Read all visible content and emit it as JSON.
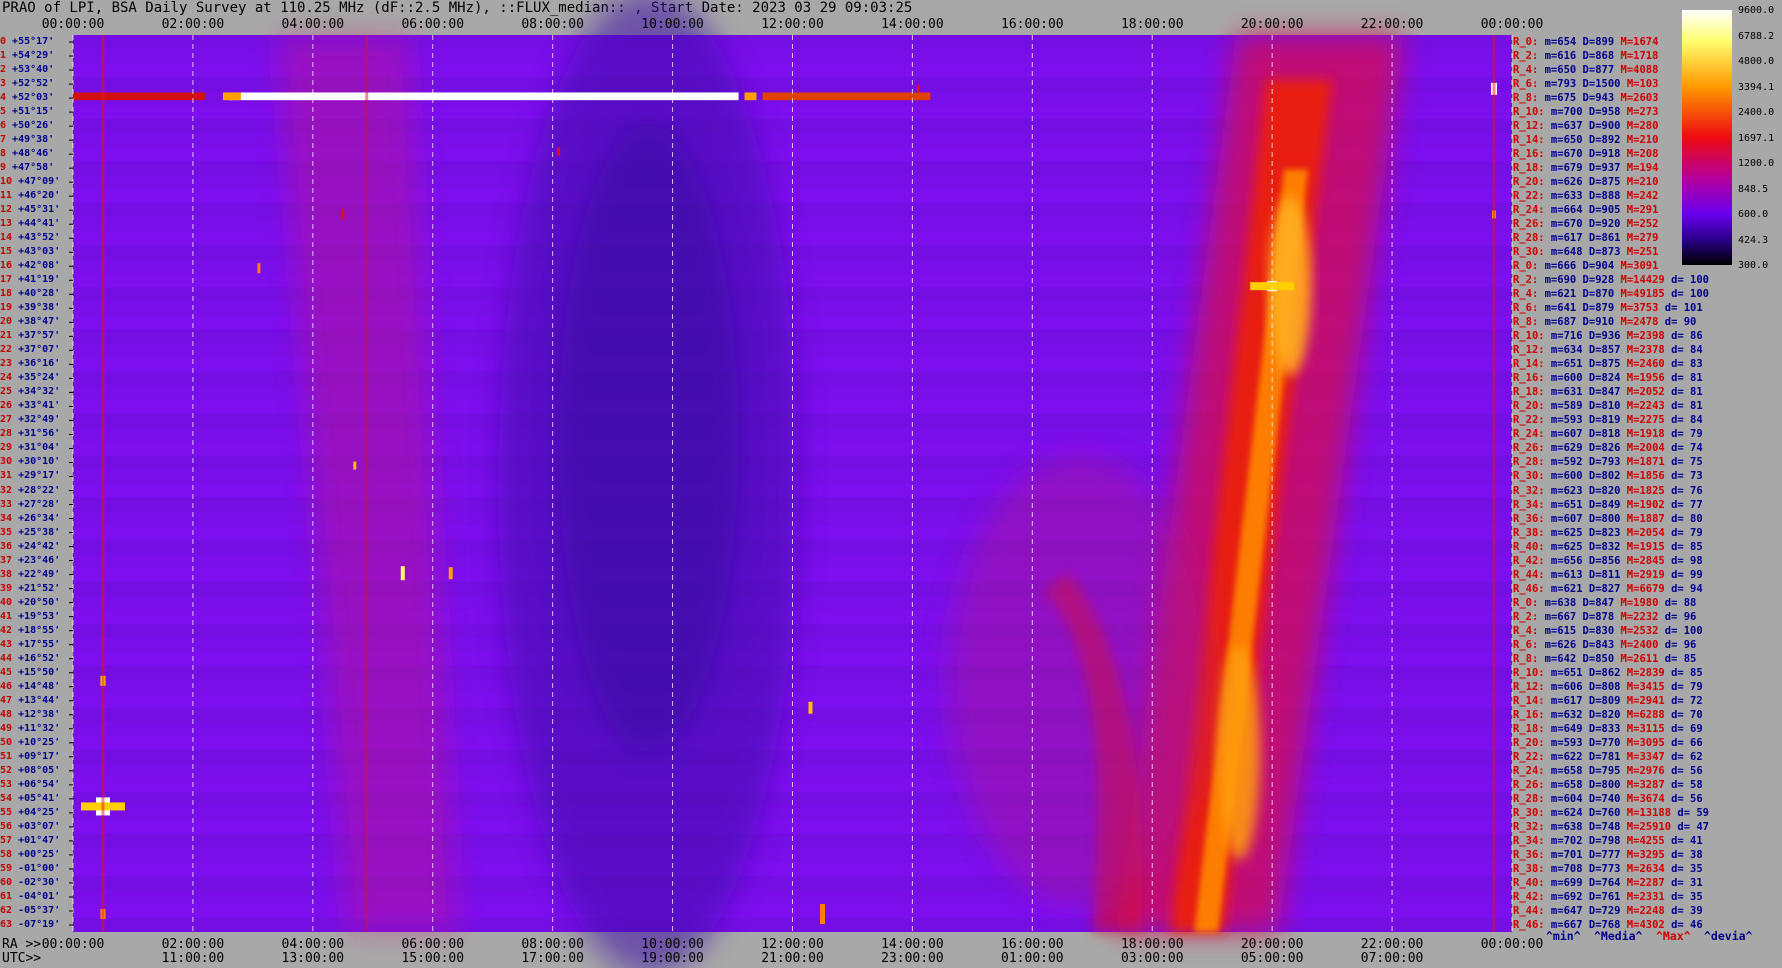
{
  "title": "PRAO of LPI, BSA Daily Survey at 110.25 MHz (dF::2.5 MHz), ::FLUX_median:: , Start Date: 2023 03 29 09:03:25",
  "corner_labels": {
    "ra": "RA >>",
    "utc": "UTC>>"
  },
  "footer_labels": {
    "min": "^min^",
    "median": "^Media^",
    "max": "^Max^",
    "devia": "^devia^"
  },
  "chart_data": {
    "type": "heatmap",
    "colors": {
      "low": "#000000",
      "mid1": "#6a00ff",
      "mid2": "#b000a0",
      "mid3": "#e80000",
      "high": "#ff9400",
      "top": "#ffffff"
    },
    "x_axis_ra": [
      "00:00:00",
      "02:00:00",
      "04:00:00",
      "06:00:00",
      "08:00:00",
      "10:00:00",
      "12:00:00",
      "14:00:00",
      "16:00:00",
      "18:00:00",
      "20:00:00",
      "22:00:00",
      "00:00:00"
    ],
    "x_axis_utc": [
      "11:00:00",
      "13:00:00",
      "15:00:00",
      "17:00:00",
      "19:00:00",
      "21:00:00",
      "23:00:00",
      "01:00:00",
      "03:00:00",
      "05:00:00",
      "07:00:00"
    ],
    "colorbar": {
      "ticks": [
        "9600.0",
        "6788.2",
        "4800.0",
        "3394.1",
        "2400.0",
        "1697.1",
        "1200.0",
        "848.5",
        "600.0",
        "424.3",
        "300.0"
      ],
      "min": 300,
      "max": 9600,
      "scale": "log"
    },
    "declinations": [
      "+55°17'",
      "+54°29'",
      "+53°40'",
      "+52°52'",
      "+52°03'",
      "+51°15'",
      "+50°26'",
      "+49°38'",
      "+48°46'",
      "+47°58'",
      "+47°09'",
      "+46°20'",
      "+45°31'",
      "+44°41'",
      "+43°52'",
      "+43°03'",
      "+42°08'",
      "+41°19'",
      "+40°28'",
      "+39°38'",
      "+38°47'",
      "+37°57'",
      "+37°07'",
      "+36°16'",
      "+35°24'",
      "+34°32'",
      "+33°41'",
      "+32°49'",
      "+31°56'",
      "+31°04'",
      "+30°10'",
      "+29°17'",
      "+28°22'",
      "+27°28'",
      "+26°34'",
      "+25°38'",
      "+24°42'",
      "+23°46'",
      "+22°49'",
      "+21°52'",
      "+20°50'",
      "+19°53'",
      "+18°55'",
      "+17°55'",
      "+16°52'",
      "+15°50'",
      "+14°48'",
      "+13°44'",
      "+12°38'",
      "+11°32'",
      "+10°25'",
      "+09°17'",
      "+08°05'",
      "+06°54'",
      "+05°41'",
      "+04°25'",
      "+03°07'",
      "+01°47'",
      "+00°25'",
      "-01°00'",
      "-02°30'",
      "-04°01'",
      "-05°37'",
      "-07°19'"
    ],
    "stats": [
      {
        "r": "R_0:",
        "min": "654",
        "med": "899",
        "max": "1674",
        "dev": ""
      },
      {
        "r": "R_2:",
        "min": "616",
        "med": "868",
        "max": "1718",
        "dev": ""
      },
      {
        "r": "R_4:",
        "min": "650",
        "med": "877",
        "max": "4088",
        "dev": ""
      },
      {
        "r": "R_6:",
        "min": "793",
        "med": "1500",
        "max": "103",
        "dev": ""
      },
      {
        "r": "R_8:",
        "min": "675",
        "med": "943",
        "max": "2603",
        "dev": ""
      },
      {
        "r": "R_10:",
        "min": "700",
        "med": "958",
        "max": "273",
        "dev": ""
      },
      {
        "r": "R_12:",
        "min": "637",
        "med": "900",
        "max": "280",
        "dev": ""
      },
      {
        "r": "R_14:",
        "min": "650",
        "med": "892",
        "max": "210",
        "dev": ""
      },
      {
        "r": "R_16:",
        "min": "670",
        "med": "918",
        "max": "208",
        "dev": ""
      },
      {
        "r": "R_18:",
        "min": "679",
        "med": "937",
        "max": "194",
        "dev": ""
      },
      {
        "r": "R_20:",
        "min": "626",
        "med": "875",
        "max": "210",
        "dev": ""
      },
      {
        "r": "R_22:",
        "min": "633",
        "med": "888",
        "max": "242",
        "dev": ""
      },
      {
        "r": "R_24:",
        "min": "664",
        "med": "905",
        "max": "291",
        "dev": ""
      },
      {
        "r": "R_26:",
        "min": "670",
        "med": "920",
        "max": "252",
        "dev": ""
      },
      {
        "r": "R_28:",
        "min": "617",
        "med": "861",
        "max": "279",
        "dev": ""
      },
      {
        "r": "R_30:",
        "min": "648",
        "med": "873",
        "max": "251",
        "dev": ""
      },
      {
        "r": "R_0:",
        "min": "666",
        "med": "904",
        "max": "3091",
        "dev": ""
      },
      {
        "r": "R_2:",
        "min": "690",
        "med": "928",
        "max": "14429",
        "dev": "100"
      },
      {
        "r": "R_4:",
        "min": "621",
        "med": "870",
        "max": "49185",
        "dev": "100"
      },
      {
        "r": "R_6:",
        "min": "641",
        "med": "879",
        "max": "3753",
        "dev": "101"
      },
      {
        "r": "R_8:",
        "min": "687",
        "med": "910",
        "max": "2478",
        "dev": "90"
      },
      {
        "r": "R_10:",
        "min": "716",
        "med": "936",
        "max": "2398",
        "dev": "86"
      },
      {
        "r": "R_12:",
        "min": "634",
        "med": "857",
        "max": "2378",
        "dev": "84"
      },
      {
        "r": "R_14:",
        "min": "651",
        "med": "875",
        "max": "2460",
        "dev": "83"
      },
      {
        "r": "R_16:",
        "min": "600",
        "med": "824",
        "max": "1956",
        "dev": "81"
      },
      {
        "r": "R_18:",
        "min": "631",
        "med": "847",
        "max": "2052",
        "dev": "81"
      },
      {
        "r": "R_20:",
        "min": "589",
        "med": "810",
        "max": "2243",
        "dev": "81"
      },
      {
        "r": "R_22:",
        "min": "593",
        "med": "819",
        "max": "2275",
        "dev": "84"
      },
      {
        "r": "R_24:",
        "min": "607",
        "med": "818",
        "max": "1918",
        "dev": "79"
      },
      {
        "r": "R_26:",
        "min": "629",
        "med": "826",
        "max": "2004",
        "dev": "74"
      },
      {
        "r": "R_28:",
        "min": "592",
        "med": "793",
        "max": "1871",
        "dev": "75"
      },
      {
        "r": "R_30:",
        "min": "600",
        "med": "802",
        "max": "1856",
        "dev": "73"
      },
      {
        "r": "R_32:",
        "min": "623",
        "med": "820",
        "max": "1825",
        "dev": "76"
      },
      {
        "r": "R_34:",
        "min": "651",
        "med": "849",
        "max": "1902",
        "dev": "77"
      },
      {
        "r": "R_36:",
        "min": "607",
        "med": "800",
        "max": "1887",
        "dev": "80"
      },
      {
        "r": "R_38:",
        "min": "625",
        "med": "823",
        "max": "2054",
        "dev": "79"
      },
      {
        "r": "R_40:",
        "min": "625",
        "med": "832",
        "max": "1915",
        "dev": "85"
      },
      {
        "r": "R_42:",
        "min": "656",
        "med": "856",
        "max": "2845",
        "dev": "98"
      },
      {
        "r": "R_44:",
        "min": "613",
        "med": "811",
        "max": "2919",
        "dev": "99"
      },
      {
        "r": "R_46:",
        "min": "621",
        "med": "827",
        "max": "6679",
        "dev": "94"
      },
      {
        "r": "R_0:",
        "min": "638",
        "med": "847",
        "max": "1980",
        "dev": "88"
      },
      {
        "r": "R_2:",
        "min": "667",
        "med": "878",
        "max": "2232",
        "dev": "96"
      },
      {
        "r": "R_4:",
        "min": "615",
        "med": "830",
        "max": "2532",
        "dev": "100"
      },
      {
        "r": "R_6:",
        "min": "626",
        "med": "843",
        "max": "2400",
        "dev": "96"
      },
      {
        "r": "R_8:",
        "min": "642",
        "med": "850",
        "max": "2611",
        "dev": "85"
      },
      {
        "r": "R_10:",
        "min": "651",
        "med": "862",
        "max": "2839",
        "dev": "85"
      },
      {
        "r": "R_12:",
        "min": "606",
        "med": "808",
        "max": "3415",
        "dev": "79"
      },
      {
        "r": "R_14:",
        "min": "617",
        "med": "809",
        "max": "2941",
        "dev": "72"
      },
      {
        "r": "R_16:",
        "min": "632",
        "med": "820",
        "max": "6288",
        "dev": "70"
      },
      {
        "r": "R_18:",
        "min": "649",
        "med": "833",
        "max": "3115",
        "dev": "69"
      },
      {
        "r": "R_20:",
        "min": "593",
        "med": "770",
        "max": "3095",
        "dev": "66"
      },
      {
        "r": "R_22:",
        "min": "622",
        "med": "781",
        "max": "3347",
        "dev": "62"
      },
      {
        "r": "R_24:",
        "min": "658",
        "med": "795",
        "max": "2976",
        "dev": "56"
      },
      {
        "r": "R_26:",
        "min": "658",
        "med": "800",
        "max": "3287",
        "dev": "58"
      },
      {
        "r": "R_28:",
        "min": "604",
        "med": "740",
        "max": "3674",
        "dev": "56"
      },
      {
        "r": "R_30:",
        "min": "624",
        "med": "760",
        "max": "13188",
        "dev": "59"
      },
      {
        "r": "R_32:",
        "min": "638",
        "med": "748",
        "max": "25910",
        "dev": "47"
      },
      {
        "r": "R_34:",
        "min": "702",
        "med": "798",
        "max": "4255",
        "dev": "41"
      },
      {
        "r": "R_36:",
        "min": "701",
        "med": "777",
        "max": "3295",
        "dev": "38"
      },
      {
        "r": "R_38:",
        "min": "708",
        "med": "773",
        "max": "2634",
        "dev": "35"
      },
      {
        "r": "R_40:",
        "min": "699",
        "med": "764",
        "max": "2287",
        "dev": "31"
      },
      {
        "r": "R_42:",
        "min": "692",
        "med": "761",
        "max": "2331",
        "dev": "35"
      },
      {
        "r": "R_44:",
        "min": "647",
        "med": "729",
        "max": "2248",
        "dev": "39"
      },
      {
        "r": "R_46:",
        "min": "667",
        "med": "768",
        "max": "4302",
        "dev": "46"
      }
    ]
  }
}
